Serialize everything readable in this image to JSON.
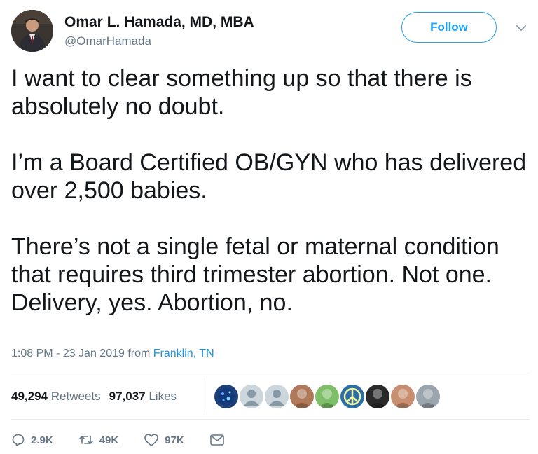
{
  "author": {
    "name": "Omar L. Hamada, MD, MBA",
    "handle": "@OmarHamada",
    "avatar_icon": "profile-photo"
  },
  "follow_label": "Follow",
  "tweet": {
    "paragraphs": [
      "I want to clear something up so that there is absolutely no doubt.",
      "I’m a Board Certified OB/GYN who has delivered over 2,500 babies.",
      "There’s not a single fetal or maternal condition that requires third trimester abortion. Not one. Delivery, yes. Abortion, no."
    ]
  },
  "meta": {
    "timestamp": "1:08 PM - 23 Jan 2019 from ",
    "location": "Franklin, TN"
  },
  "stats": {
    "retweets_count": "49,294",
    "retweets_label": "Retweets",
    "likes_count": "97,037",
    "likes_label": "Likes"
  },
  "likers": [
    {
      "icon": "globe-avatar",
      "color": "#1d3f7a"
    },
    {
      "icon": "default-avatar",
      "color": "#ccd6dd"
    },
    {
      "icon": "default-avatar",
      "color": "#ccd6dd"
    },
    {
      "icon": "photo-avatar",
      "color": "#b07a5a"
    },
    {
      "icon": "photo-avatar",
      "color": "#7fbf6a"
    },
    {
      "icon": "peace-sign-avatar",
      "color": "#2c6fa8"
    },
    {
      "icon": "photo-avatar",
      "color": "#2a2a2a"
    },
    {
      "icon": "photo-avatar",
      "color": "#c78f6f"
    },
    {
      "icon": "photo-avatar",
      "color": "#9aa5ad"
    }
  ],
  "actions": {
    "reply_count": "2.9K",
    "retweet_count": "49K",
    "like_count": "97K"
  },
  "colors": {
    "accent": "#1da1f2",
    "link": "#1b95e0",
    "secondary_text": "#657786"
  }
}
